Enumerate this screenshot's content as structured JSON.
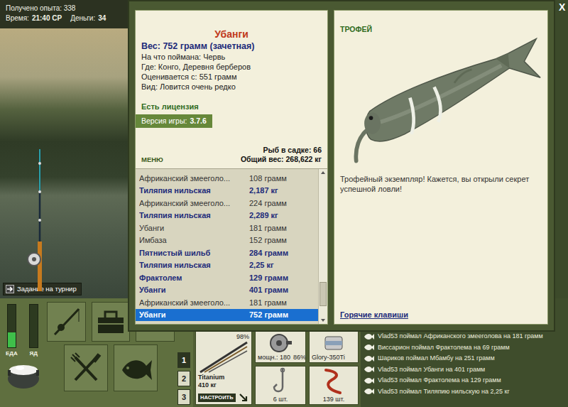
{
  "hud": {
    "experience": "Получено опыта: 338",
    "time_label": "Время:",
    "time": "21:40 СР",
    "money_label": "Деньги:",
    "money": "34"
  },
  "tournament_button": {
    "label": "Задание на турнир"
  },
  "meters": [
    {
      "label": "ЕДА",
      "level": 0.35
    },
    {
      "label": "ЯД",
      "level": 0
    }
  ],
  "slots": [
    {
      "label": "1",
      "selected": true
    },
    {
      "label": "2",
      "selected": false
    },
    {
      "label": "3",
      "selected": false
    }
  ],
  "tackle": {
    "rod_condition": "98%",
    "rod_name": "Titanium",
    "rod_load": "410 кг",
    "setup_button": "НАСТРОИТЬ",
    "reel_power": "мощн.: 180",
    "reel_condition": "86%",
    "line_name": "Glory-350Ti",
    "hooks": "6 шт.",
    "bait": "139 шт."
  },
  "chat": [
    "Vlad53 поймал Африканского змееголова на 181 грамм",
    "Виссарион поймал Фрактолема на 69 грамм",
    "Шариков поймал Мбамбу на 251 грамм",
    "Vlad53 поймал Убанги на 401 грамм",
    "Vlad53 поймал Фрактолема на 129 грамм",
    "Vlad53 поймал Тиляпию нильскую на 2,25 кг"
  ],
  "dialog": {
    "close": "X",
    "info": {
      "title": "Убанги",
      "weight": "Вес: 752 грамм (зачетная)",
      "details": [
        "На что поймана: Червь",
        "Где: Конго, Деревня берберов",
        "Оценивается с: 551 грамм",
        "Вид: Ловится очень редко"
      ],
      "license": "Есть лицензия",
      "version_label": "Версия игры:",
      "version": "3.7.6"
    },
    "stats": {
      "menu": "МЕНЮ",
      "fish_count": "Рыб в садке: 66",
      "total_weight": "Общий вес: 268,622 кг"
    },
    "catch_list": [
      {
        "name": "Африканский змееголо...",
        "weight": "108 грамм",
        "credited": false,
        "selected": false
      },
      {
        "name": "Тиляпия нильская",
        "weight": "2,187 кг",
        "credited": true,
        "selected": false
      },
      {
        "name": "Африканский змееголо...",
        "weight": "224 грамм",
        "credited": false,
        "selected": false
      },
      {
        "name": "Тиляпия нильская",
        "weight": "2,289 кг",
        "credited": true,
        "selected": false
      },
      {
        "name": "Убанги",
        "weight": "181 грамм",
        "credited": false,
        "selected": false
      },
      {
        "name": "Имбаза",
        "weight": "152 грамм",
        "credited": false,
        "selected": false
      },
      {
        "name": "Пятнистый шильб",
        "weight": "284 грамм",
        "credited": true,
        "selected": false
      },
      {
        "name": "Тиляпия нильская",
        "weight": "2,25 кг",
        "credited": true,
        "selected": false
      },
      {
        "name": "Фрактолем",
        "weight": "129 грамм",
        "credited": true,
        "selected": false
      },
      {
        "name": "Убанги",
        "weight": "401 грамм",
        "credited": true,
        "selected": false
      },
      {
        "name": "Африканский змееголо...",
        "weight": "181 грамм",
        "credited": false,
        "selected": false
      },
      {
        "name": "Убанги",
        "weight": "752 грамм",
        "credited": true,
        "selected": true
      }
    ],
    "catch_scroll": {
      "level": 0.92
    },
    "trophy": {
      "heading": "ТРОФЕЙ",
      "message": "Трофейный экземпляр! Кажется, вы открыли секрет успешной ловли!",
      "hotkeys": "Горячие клавиши"
    }
  }
}
